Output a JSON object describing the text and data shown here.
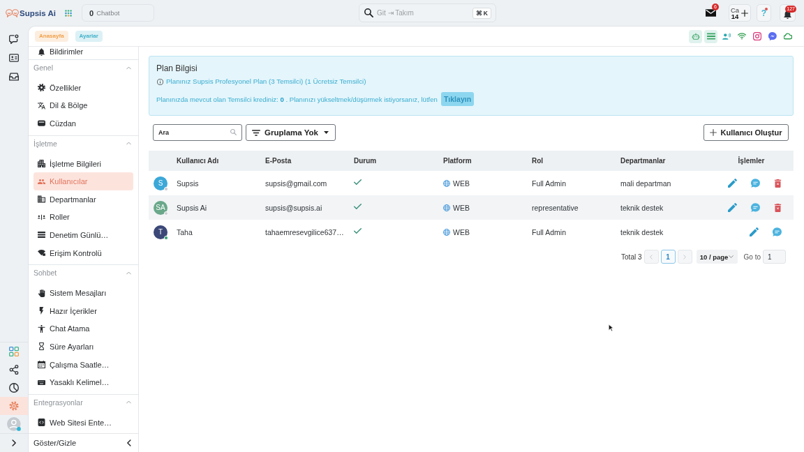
{
  "topbar": {
    "brand": "Supsis Ai",
    "chatbot": {
      "count": "0",
      "label": "Chatbot"
    },
    "search": {
      "placeholder": "Git ⇥ Takım",
      "shortcut": "⌘ K"
    },
    "mail_badge": "6",
    "credit": {
      "label": "Ca",
      "value": "14"
    },
    "help": {
      "label": "?",
      "alert": true
    },
    "notifications_badge": "127"
  },
  "rail": {
    "top": [
      {
        "kind": "chat",
        "selected": false
      },
      {
        "kind": "contact-card",
        "selected": false
      },
      {
        "kind": "inbox",
        "selected": false
      }
    ],
    "bottom": [
      {
        "kind": "apps",
        "selected": false
      },
      {
        "kind": "share",
        "selected": false
      },
      {
        "kind": "pie-chart",
        "selected": false
      },
      {
        "kind": "settings",
        "selected": true
      }
    ]
  },
  "breadcrumb": [
    {
      "label": "Anasayfa",
      "color": "#f0a04b"
    },
    {
      "label": "Ayarlar",
      "color": "#3fb0c9"
    }
  ],
  "channels": [
    {
      "kind": "bot",
      "selected": true
    },
    {
      "kind": "list",
      "selected": true
    },
    {
      "kind": "voice",
      "selected": false
    },
    {
      "kind": "wifi",
      "selected": false
    },
    {
      "kind": "camera",
      "selected": false
    },
    {
      "kind": "messenger",
      "selected": false
    },
    {
      "kind": "cloud",
      "selected": false
    }
  ],
  "sidebar": {
    "sections": [
      {
        "items": [
          {
            "label": "Bildirimler",
            "kind": "bell",
            "selected": false
          }
        ]
      },
      {
        "title": "Genel",
        "expanded": true,
        "items": [
          {
            "label": "Özellikler",
            "kind": "gear",
            "selected": false
          },
          {
            "label": "Dil & Bölge",
            "kind": "translate",
            "selected": false
          },
          {
            "label": "Cüzdan",
            "kind": "wallet",
            "selected": false
          }
        ]
      },
      {
        "title": "İşletme",
        "expanded": true,
        "items": [
          {
            "label": "İşletme Bilgileri",
            "kind": "building",
            "selected": false
          },
          {
            "label": "Kullanıcılar",
            "kind": "users",
            "selected": true
          },
          {
            "label": "Departmanlar",
            "kind": "office",
            "selected": false
          },
          {
            "label": "Roller",
            "kind": "roles",
            "selected": false
          },
          {
            "label": "Denetim Günlü…",
            "kind": "log",
            "selected": false
          },
          {
            "label": "Erişim Kontrolü",
            "kind": "access",
            "selected": false
          }
        ]
      },
      {
        "title": "Sohbet",
        "expanded": true,
        "items": [
          {
            "label": "Sistem Mesajları",
            "kind": "hands",
            "selected": false
          },
          {
            "label": "Hazır İçerikler",
            "kind": "bolt",
            "selected": false
          },
          {
            "label": "Chat Atama",
            "kind": "person",
            "selected": false
          },
          {
            "label": "Süre Ayarları",
            "kind": "hourglass",
            "selected": false
          },
          {
            "label": "Çalışma Saatle…",
            "kind": "calendar",
            "selected": false
          },
          {
            "label": "Yasaklı Kelimel…",
            "kind": "keyboard",
            "selected": false
          }
        ]
      },
      {
        "title": "Entegrasyonlar",
        "expanded": true,
        "items": [
          {
            "label": "Web Sitesi Ente…",
            "kind": "code",
            "selected": false
          }
        ]
      }
    ],
    "footer": "Göster/Gizle"
  },
  "plan": {
    "title": "Plan Bilgisi",
    "info": "Planınız Supsis Profesyonel Plan (3 Temsilci) (1 Ücretsiz Temsilci)",
    "credit": "Planınızda mevcut olan Temsilci krediniz: **0** . Planınızı yükseltmek/düşürmek istiyorsanız, lütfen",
    "action": "Tıklayın"
  },
  "toolbar": {
    "search": {
      "placeholder": "Ara"
    },
    "grouping": "Gruplama Yok",
    "create": "Kullanıcı Oluştur"
  },
  "table": {
    "columns": [
      "Kullanıcı Adı",
      "E-Posta",
      "Durum",
      "Platform",
      "Rol",
      "Departmanlar",
      "İşlemler"
    ],
    "rows": [
      {
        "avatar": "S",
        "color": "#3ba8d8",
        "online": false,
        "name": "Supsis",
        "email": "supsis@gmail.com",
        "active": true,
        "platform": "WEB",
        "role": "Full Admin",
        "department": "mali departman",
        "actions": [
          {
            "kind": "edit"
          },
          {
            "kind": "chat"
          },
          {
            "kind": "delete"
          }
        ]
      },
      {
        "avatar": "SA",
        "color": "#6aa88a",
        "online": false,
        "name": "Supsis Ai",
        "email": "supsis@supsis.ai",
        "active": true,
        "platform": "WEB",
        "role": "representative",
        "department": "teknik destek",
        "actions": [
          {
            "kind": "edit"
          },
          {
            "kind": "chat"
          },
          {
            "kind": "delete"
          }
        ]
      },
      {
        "avatar": "T",
        "color": "#3b4878",
        "online": true,
        "name": "Taha",
        "email": "tahaemresevgilice637…",
        "active": true,
        "platform": "WEB",
        "role": "Full Admin",
        "department": "teknik destek",
        "actions": [
          {
            "kind": "edit"
          },
          {
            "kind": "chat"
          }
        ]
      }
    ]
  },
  "pagination": {
    "total": "Total 3",
    "previous_disabled": true,
    "pages": [
      {
        "label": "1",
        "selected": true
      }
    ],
    "next_disabled": true,
    "page_size": "10 / page",
    "goto_label": "Go to",
    "goto_value": "1"
  }
}
